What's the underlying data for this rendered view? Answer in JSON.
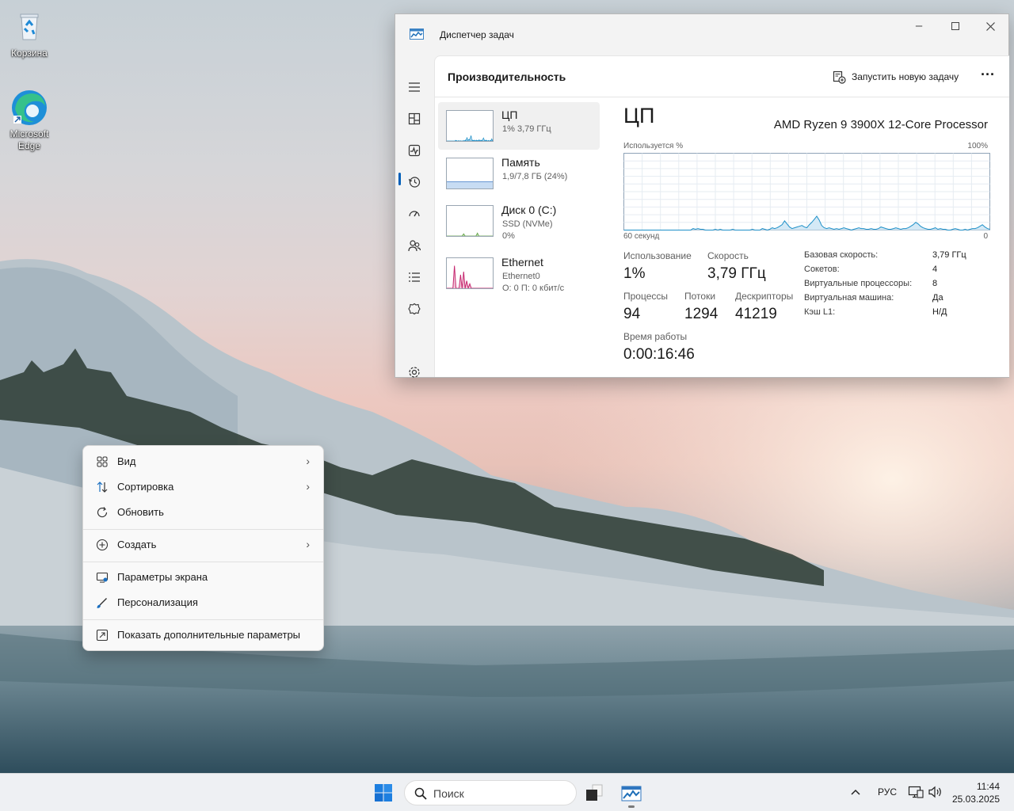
{
  "desktop": {
    "icons": [
      {
        "label": "Корзина",
        "icon": "recycle-bin-icon"
      },
      {
        "label": "Microsoft Edge",
        "icon": "edge-icon"
      }
    ]
  },
  "taskmanager": {
    "window_title": "Диспетчер задач",
    "page_title": "Производительность",
    "run_task_label": "Запустить новую задачу",
    "more_label": "···",
    "rail": [
      "menu-icon",
      "processes-icon",
      "performance-icon",
      "history-icon",
      "startup-icon",
      "users-icon",
      "details-icon",
      "services-icon",
      "settings-icon"
    ],
    "items": {
      "cpu": {
        "name": "ЦП",
        "sub": "1% 3,79 ГГц"
      },
      "memory": {
        "name": "Память",
        "sub": "1,9/7,8 ГБ (24%)"
      },
      "disk": {
        "name": "Диск 0 (C:)",
        "sub1": "SSD (NVMe)",
        "sub2": "0%"
      },
      "ethernet": {
        "name": "Ethernet",
        "sub1": "Ethernet0",
        "sub2": "О: 0 П: 0 кбит/с"
      }
    },
    "cpu": {
      "title": "ЦП",
      "model": "AMD Ryzen 9 3900X 12-Core Processor",
      "graph_label": "Используется %",
      "graph_max": "100%",
      "graph_time": "60 секунд",
      "graph_min": "0",
      "usage_label": "Использование",
      "usage": "1%",
      "speed_label": "Скорость",
      "speed": "3,79 ГГц",
      "processes_label": "Процессы",
      "processes": "94",
      "threads_label": "Потоки",
      "threads": "1294",
      "handles_label": "Дескрипторы",
      "handles": "41219",
      "uptime_label": "Время работы",
      "uptime": "0:00:16:46",
      "details": [
        {
          "key": "Базовая скорость:",
          "value": "3,79 ГГц"
        },
        {
          "key": "Сокетов:",
          "value": "4"
        },
        {
          "key": "Виртуальные процессоры:",
          "value": "8"
        },
        {
          "key": "Виртуальная машина:",
          "value": "Да"
        },
        {
          "key": "Кэш L1:",
          "value": "Н/Д"
        }
      ],
      "usage_history": [
        0,
        0,
        0,
        0,
        0,
        0,
        0,
        0,
        0,
        0,
        0,
        0,
        0,
        0,
        0,
        0,
        0,
        0,
        0,
        0,
        0,
        0,
        0,
        0,
        0,
        0,
        0,
        0,
        2,
        1,
        2,
        1,
        1,
        0,
        0,
        0,
        0,
        1,
        0,
        1,
        0,
        0,
        0,
        0,
        1,
        0,
        0,
        0,
        0,
        0,
        0,
        0,
        1,
        0,
        0,
        0,
        2,
        1,
        0,
        1,
        3,
        2,
        3,
        5,
        7,
        12,
        8,
        4,
        2,
        3,
        4,
        5,
        6,
        4,
        3,
        7,
        10,
        14,
        18,
        13,
        6,
        3,
        2,
        3,
        2,
        1,
        2,
        1,
        2,
        3,
        2,
        1,
        0,
        1,
        2,
        3,
        2,
        2,
        1,
        1,
        2,
        1,
        1,
        2,
        4,
        3,
        2,
        1,
        1,
        2,
        3,
        2,
        1,
        2,
        2,
        3,
        5,
        7,
        10,
        8,
        5,
        3,
        2,
        1,
        1,
        2,
        3,
        1,
        2,
        1,
        1,
        0,
        0,
        1,
        2,
        1,
        0,
        0,
        1,
        0,
        1,
        2,
        2,
        3,
        5,
        7,
        4,
        2,
        1
      ]
    }
  },
  "context_menu": {
    "items": [
      {
        "label": "Вид",
        "icon": "view-grid-icon",
        "submenu": true
      },
      {
        "label": "Сортировка",
        "icon": "sort-icon",
        "submenu": true
      },
      {
        "label": "Обновить",
        "icon": "refresh-icon",
        "submenu": false
      },
      {
        "label": "Создать",
        "icon": "new-plus-icon",
        "submenu": true
      },
      {
        "label": "Параметры экрана",
        "icon": "display-settings-icon",
        "submenu": false
      },
      {
        "label": "Персонализация",
        "icon": "brush-icon",
        "submenu": false
      },
      {
        "label": "Показать дополнительные параметры",
        "icon": "more-options-icon",
        "submenu": false
      }
    ],
    "chevron": "›"
  },
  "taskbar": {
    "search_placeholder": "Поиск",
    "language": "РУС",
    "time": "11:44",
    "date": "25.03.2025"
  },
  "colors": {
    "accent": "#005fb8",
    "cpu_graph": "#1e90c8",
    "ethernet_graph": "#c5256e",
    "memory_graph": "#7aa7d9"
  }
}
